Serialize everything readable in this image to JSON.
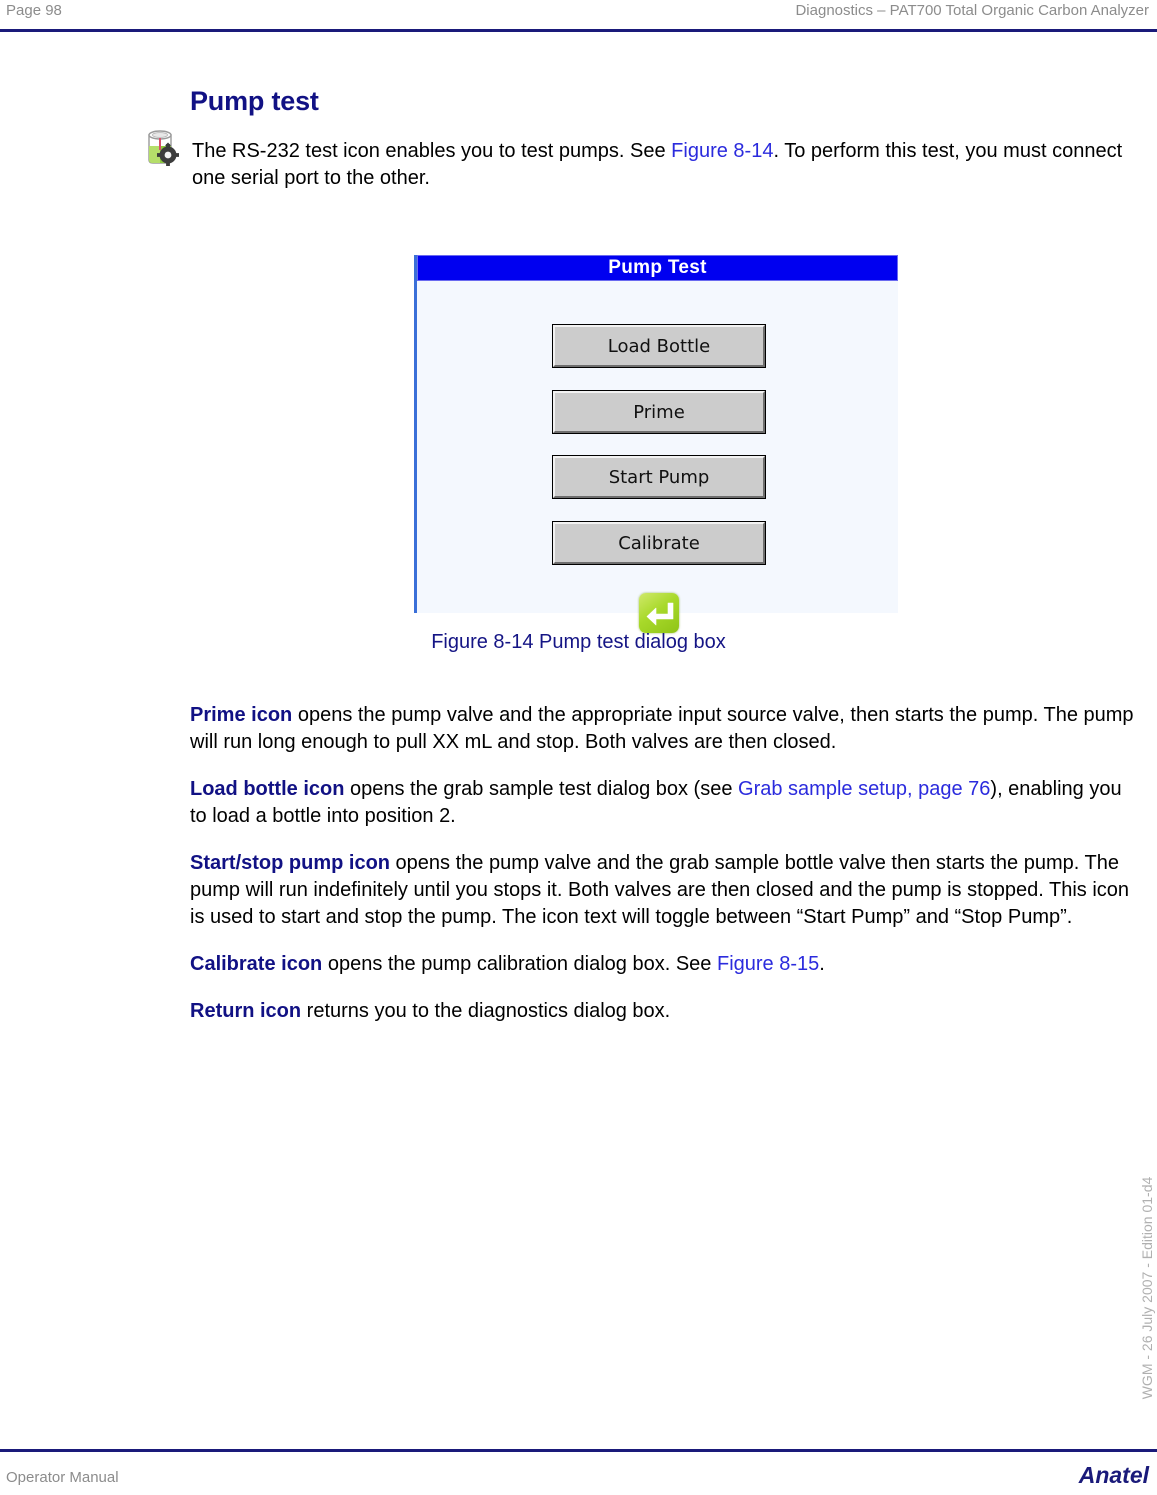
{
  "header": {
    "page_number": "Page 98",
    "title": "Diagnostics – PAT700 Total Organic Carbon Analyzer",
    "rule_color": "#1a1a7a",
    "text_color": "#8c8c8c"
  },
  "section": {
    "heading": "Pump test",
    "heading_color": "#111184"
  },
  "intro": {
    "icon_name": "beaker-gear-icon",
    "text_before_link": "The RS-232 test icon enables you to test pumps. See ",
    "link": "Figure 8-14",
    "text_after_link": ". To perform this test, you must connect one serial port to the other.",
    "link_color": "#2b2bdd"
  },
  "figure": {
    "caption": "Figure 8-14 Pump test dialog box",
    "caption_color": "#151585",
    "dialog": {
      "title": "Pump Test",
      "titlebar_color": "#0000f0",
      "title_text_color": "#ffffff",
      "body_color": "#f4f8fe",
      "border_color": "#3a6fd8",
      "buttons": [
        {
          "label": "Load Bottle",
          "name": "load-bottle-button"
        },
        {
          "label": "Prime",
          "name": "prime-button"
        },
        {
          "label": "Start Pump",
          "name": "start-pump-button"
        },
        {
          "label": "Calibrate",
          "name": "calibrate-button"
        }
      ],
      "return_icon": {
        "name": "return-icon",
        "color": "#a8d92a",
        "glyph": "return-arrow"
      }
    }
  },
  "body": {
    "paragraphs": [
      {
        "lead": "Prime icon",
        "text": " opens the pump valve and the appropriate input source valve, then starts the pump. The pump will run long enough to pull XX mL and stop. Both valves are then closed."
      },
      {
        "lead": "Load bottle icon",
        "text_before_link": " opens the grab sample test dialog box (see ",
        "link": "Grab sample setup, page 76",
        "text_after_link": "), enabling you to load a bottle into position 2."
      },
      {
        "lead": "Start/stop pump icon",
        "text": " opens the pump valve and the grab sample bottle valve then starts the pump. The pump will run indefinitely until you stops it. Both valves are then closed and the pump is stopped. This icon is used to start and stop the pump. The icon text will toggle between “Start Pump” and “Stop Pump”."
      },
      {
        "lead": "Calibrate icon",
        "text_before_link": " opens the pump calibration dialog box. See ",
        "link": "Figure 8-15",
        "text_after_link": "."
      },
      {
        "lead": "Return icon",
        "text": " returns you to the diagnostics dialog box."
      }
    ],
    "lead_color": "#111184",
    "link_color": "#2b2bdd"
  },
  "side_note": {
    "text": "WGM - 26 July 2007 - Edition 01-d4",
    "color": "#b0b0b0"
  },
  "footer": {
    "left": "Operator Manual",
    "right": "Anatel",
    "rule_color": "#1a1a7a",
    "left_color": "#8c8c8c",
    "right_color": "#1a1a7a"
  }
}
